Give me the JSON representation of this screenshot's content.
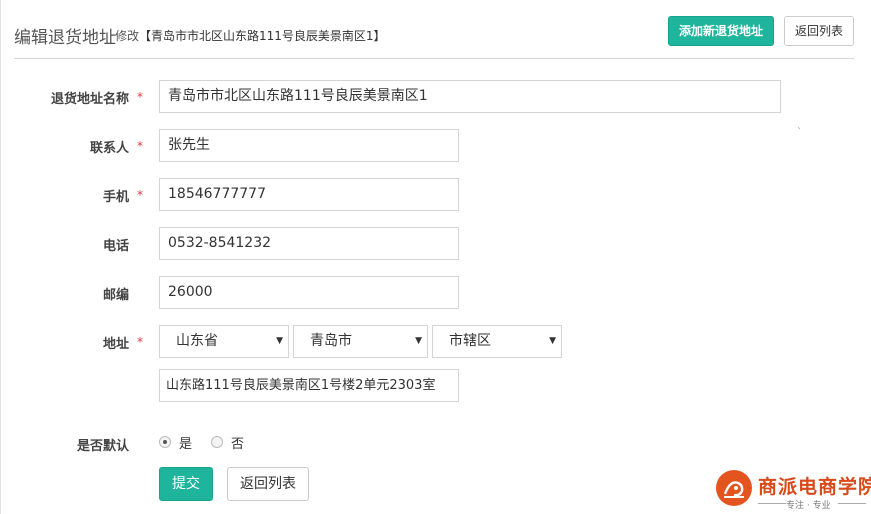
{
  "header": {
    "title": "编辑退货地址",
    "subtitle_prefix": "修改",
    "subtitle_detail": "【青岛市市北区山东路111号良辰美景南区1】",
    "add_button": "添加新退货地址",
    "back_button": "返回列表"
  },
  "form": {
    "name": {
      "label": "退货地址名称",
      "required": "*",
      "value": "青岛市市北区山东路111号良辰美景南区1"
    },
    "contact": {
      "label": "联系人",
      "required": "*",
      "value": "张先生"
    },
    "mobile": {
      "label": "手机",
      "required": "*",
      "value": "18546777777"
    },
    "phone": {
      "label": "电话",
      "value": "0532-8541232"
    },
    "zip": {
      "label": "邮编",
      "value": "26000"
    },
    "address": {
      "label": "地址",
      "required": "*",
      "province": "山东省",
      "city": "青岛市",
      "district": "市辖区",
      "detail": "山东路111号良辰美景南区1号楼2单元2303室"
    },
    "default": {
      "label": "是否默认",
      "yes": "是",
      "no": "否",
      "selected": "是"
    }
  },
  "actions": {
    "submit": "提交",
    "back": "返回列表"
  },
  "logo": {
    "text": "商派电商学院",
    "slogan": "专注 · 专业"
  },
  "colors": {
    "primary": "#1fb59c",
    "required": "#e03b3b",
    "logo": "#e4541f"
  },
  "icons": {
    "select_arrow": "chevron-down-icon",
    "radio": "radio-icon"
  }
}
